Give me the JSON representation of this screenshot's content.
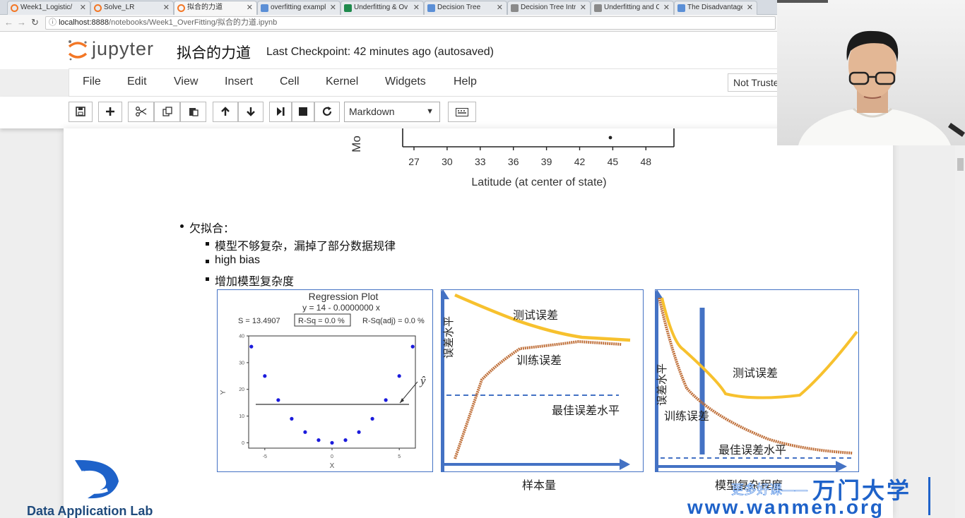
{
  "browser": {
    "tabs": [
      {
        "title": "Week1_Logistic/",
        "icon": "jupyter-icon",
        "active": false
      },
      {
        "title": "Solve_LR",
        "icon": "jupyter-icon",
        "active": false
      },
      {
        "title": "拟合的力道",
        "icon": "jupyter-icon",
        "active": true
      },
      {
        "title": "overfitting exampl",
        "icon": "paw-icon",
        "active": false
      },
      {
        "title": "Underfitting & Ov",
        "icon": "sheet-icon",
        "active": false
      },
      {
        "title": "Decision Tree",
        "icon": "page-icon",
        "active": false
      },
      {
        "title": "Decision Tree Intr",
        "icon": "page-icon",
        "active": false
      },
      {
        "title": "Underfitting and C",
        "icon": "page-icon",
        "active": false
      },
      {
        "title": "The Disadvantage",
        "icon": "page-icon",
        "active": false
      }
    ],
    "url_host": "localhost:8888",
    "url_path": "/notebooks/Week1_OverFitting/拟合的力道.ipynb"
  },
  "jupyter": {
    "logo_text": "jupyter",
    "notebook_name": "拟合的力道",
    "checkpoint": "Last Checkpoint: 42 minutes ago (autosaved)",
    "menu": [
      "File",
      "Edit",
      "View",
      "Insert",
      "Cell",
      "Kernel",
      "Widgets",
      "Help"
    ],
    "trust_label": "Not Trusted",
    "cell_type": "Markdown"
  },
  "top_chart": {
    "ylabel_fragment": "Mo",
    "xlabel": "Latitude (at center of state)",
    "ticks": [
      "27",
      "30",
      "33",
      "36",
      "39",
      "42",
      "45",
      "48"
    ]
  },
  "content": {
    "bullet_main": "欠拟合：",
    "sub_bullets": [
      "模型不够复杂，漏掉了部分数据规律",
      "high bias",
      "增加模型复杂度"
    ]
  },
  "regression_plot": {
    "title": "Regression Plot",
    "equation": "y = 14 - 0.0000000 x",
    "s_label": "S = 13.4907",
    "rsq_label": "R-Sq = 0.0 %",
    "rsqadj_label": "R-Sq(adj) = 0.0 %",
    "xlabel": "X",
    "ylabel": "Y",
    "yhat_label": "ŷ",
    "xticks": [
      "-5",
      "0",
      "5"
    ],
    "yticks": [
      "0",
      "10",
      "20",
      "30",
      "40"
    ]
  },
  "curve_chart_1": {
    "test_label": "测试误差",
    "train_label": "训练误差",
    "best_label": "最佳误差水平",
    "ylabel": "误差水平",
    "xlabel": "样本量"
  },
  "curve_chart_2": {
    "test_label": "测试误差",
    "train_label": "训练误差",
    "best_label": "最佳误差水平",
    "ylabel": "误差水平",
    "xlabel": "模型复杂程度"
  },
  "watermark": {
    "line1": "更多好课——",
    "brand": "万门大学",
    "url": "www.wanmen.org",
    "lab": "Data Application Lab"
  },
  "colors": {
    "orange": "#f37726",
    "test_curve": "#f7c12e",
    "train_curve": "#c0703a",
    "axis_blue": "#4472c4",
    "brand_blue": "#1e62c9"
  }
}
